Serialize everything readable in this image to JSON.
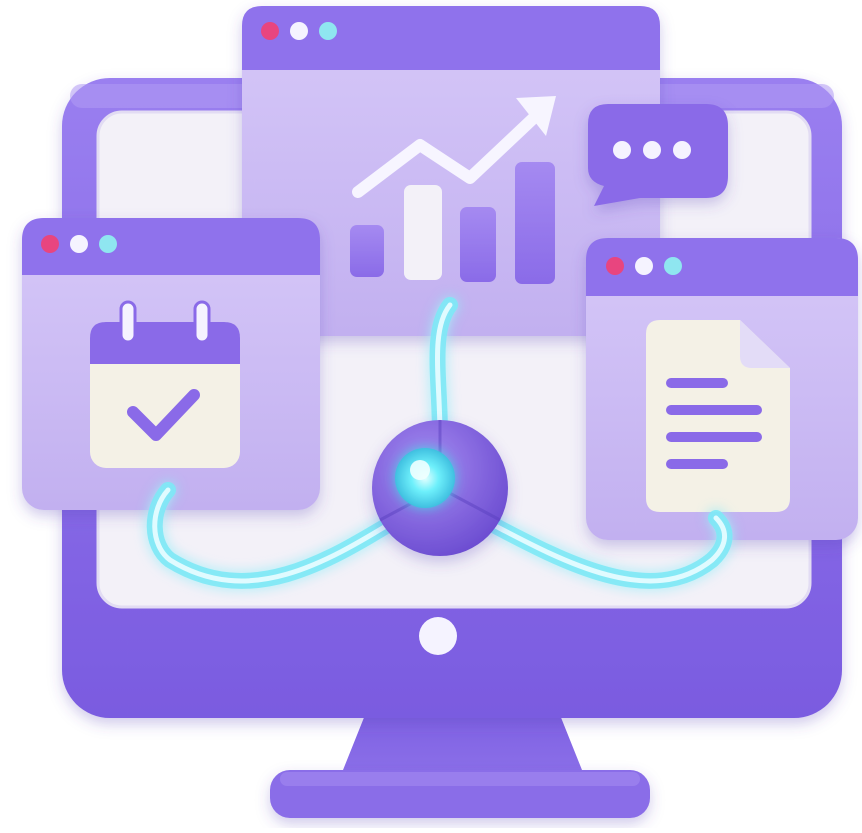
{
  "illustration": {
    "subject": "desktop-monitor-workflow",
    "icons": [
      "monitor-icon",
      "growth-chart-icon",
      "chat-bubble-icon",
      "calendar-check-icon",
      "document-icon",
      "connection-hub-icon"
    ],
    "colors": {
      "frame_purple": "#8a6be8",
      "frame_purple_dark": "#6f4fd6",
      "panel_lavender": "#c9b8f3",
      "panel_lavender_light": "#ddd1fa",
      "screen_white": "#f2f0f7",
      "glow_cyan": "#5fe3f2",
      "dot_pink": "#e8457f",
      "dot_white": "#f5f3ff",
      "dot_cyan": "#8fe6f0"
    }
  }
}
